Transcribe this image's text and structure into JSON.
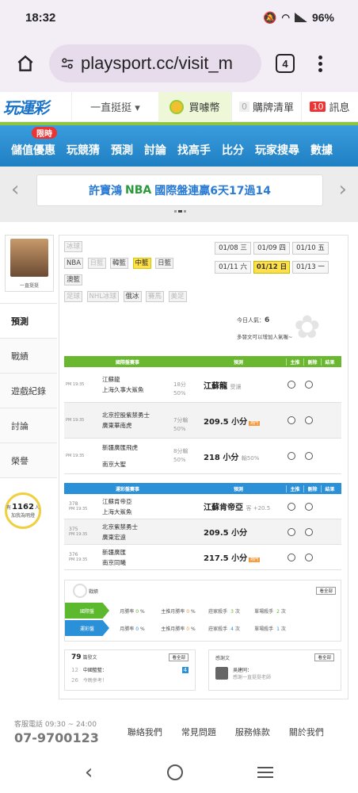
{
  "status": {
    "time": "18:32",
    "battery": "96%"
  },
  "browser": {
    "url": "playsport.cc/visit_m",
    "tab_count": "4"
  },
  "site": {
    "logo": "玩運彩",
    "user_dropdown": "一直挺挺 ▾",
    "coin_label": "買噱幣",
    "cart_count": "0",
    "cart_label": "購牌清單",
    "msg_count": "10",
    "msg_label": "訊息"
  },
  "menu": {
    "limited_badge": "限時",
    "items": [
      "儲值優惠",
      "玩競猜",
      "預測",
      "討論",
      "找高手",
      "比分",
      "玩家搜尋",
      "數據"
    ]
  },
  "marquee": {
    "name": "許寶鴻",
    "league": "NBA",
    "text": "國際盤連贏6天17過14"
  },
  "profile": {
    "name": "一直挺挺"
  },
  "side_tabs": [
    "預測",
    "戰績",
    "遊戲紀錄",
    "討論",
    "榮譽"
  ],
  "bulb": {
    "count": "1162",
    "unit": "人",
    "text": "加我為明燈",
    "prefix": "有"
  },
  "leagues": {
    "row1": [
      {
        "label": "冰球",
        "dim": true
      }
    ],
    "row2": [
      {
        "label": "NBA",
        "dim": false
      },
      {
        "label": "日籃",
        "dim": true
      },
      {
        "label": "韓籃",
        "dim": false
      },
      {
        "label": "中籃",
        "dim": false,
        "hl": true
      },
      {
        "label": "日籃",
        "dim": false
      }
    ],
    "row3": [
      {
        "label": "澳籃",
        "dim": false
      }
    ],
    "row4": [
      {
        "label": "足球",
        "dim": true
      },
      {
        "label": "NHL冰球",
        "dim": true
      },
      {
        "label": "俄冰",
        "dim": false
      },
      {
        "label": "賽馬",
        "dim": true
      },
      {
        "label": "美足",
        "dim": true
      }
    ]
  },
  "dates": [
    {
      "label": "01/08 三",
      "hl": false
    },
    {
      "label": "01/09 四",
      "hl": false
    },
    {
      "label": "01/10 五",
      "hl": false
    },
    {
      "label": "01/11 六",
      "hl": false
    },
    {
      "label": "01/12 日",
      "hl": true
    },
    {
      "label": "01/13 一",
      "hl": false
    }
  ],
  "today": {
    "label": "今日人氣：",
    "value": "6",
    "note": "多發文可以增加人氣喔~"
  },
  "intl_table": {
    "header": [
      "國際盤賽事",
      "預測",
      "主推",
      "刪除",
      "結果"
    ],
    "rows": [
      {
        "time": "PM 19:35",
        "teams": [
          "江蘇龍",
          "上海久事大鯊魚"
        ],
        "odds": [
          "18分",
          "50%"
        ],
        "pred": "江蘇龍",
        "sub": "受讓",
        "hot": ""
      },
      {
        "time": "PM 19:35",
        "teams": [
          "北京控股紫禁勇士",
          "廣東華南虎"
        ],
        "odds": [
          "7分輸",
          "50%"
        ],
        "pred": "209.5 小分",
        "sub": "",
        "hot": "熱門"
      },
      {
        "time": "PM 19:35",
        "teams": [
          "新疆廣匯飛虎",
          "南京大聖"
        ],
        "odds": [
          "8分輸",
          "50%"
        ],
        "pred": "218 小分",
        "sub": "輸50%",
        "hot": ""
      }
    ]
  },
  "local_table": {
    "header": [
      "運彩盤賽事",
      "預測",
      "主推",
      "刪除",
      "結果"
    ],
    "rows": [
      {
        "num": "378",
        "time": "PM 19:35",
        "teams": [
          "江蘇肯帝亞",
          "上海大鯊魚"
        ],
        "pred": "江蘇肯帝亞",
        "sub": "客 +20.5",
        "hot": ""
      },
      {
        "num": "375",
        "time": "PM 19:35",
        "teams": [
          "北京紫禁勇士",
          "廣東宏遠"
        ],
        "pred": "209.5 小分",
        "sub": "",
        "hot": ""
      },
      {
        "num": "376",
        "time": "PM 19:35",
        "teams": [
          "新疆廣匯",
          "南京同曦"
        ],
        "pred": "217.5 小分",
        "sub": "",
        "hot": "熱門"
      }
    ]
  },
  "stats": {
    "title": "戰績",
    "more": "看全部",
    "rows": [
      {
        "badge": "國際盤",
        "c1": "月勝率",
        "v1": "0",
        "c2": "主推月勝率",
        "v2": "0",
        "c3": "莊家殺手",
        "v3": "3",
        "c4": "單場殺手",
        "v4": "2"
      },
      {
        "badge": "運彩盤",
        "c1": "月勝率",
        "v1": "0",
        "c2": "主推月勝率",
        "v2": "0",
        "c3": "莊家殺手",
        "v3": "4",
        "c4": "單場殺手",
        "v4": "1"
      }
    ]
  },
  "articles": {
    "count": "79",
    "label": "篇發文",
    "more": "看全部",
    "date": "12",
    "date2": "26",
    "title": "中國籃籃：",
    "sub": "今晚參考！",
    "badge_prefix": "推",
    "badge": "4"
  },
  "mentions": {
    "label": "感謝文",
    "more": "看全部",
    "title": "吳建同：",
    "sub": "感謝一直挺挺老師"
  },
  "footer": {
    "call_label": "客服電話 09:30 ~ 24:00",
    "phone": "07-9700123",
    "links": [
      "聯絡我們",
      "常見問題",
      "服務條款",
      "關於我們"
    ]
  }
}
